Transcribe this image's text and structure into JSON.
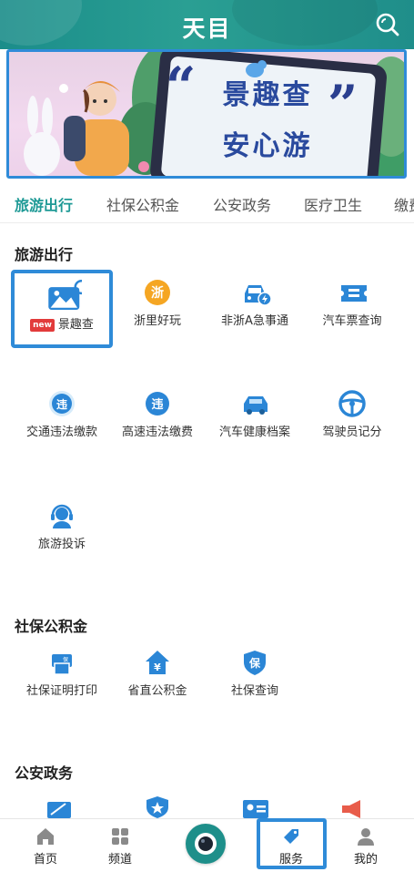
{
  "header": {
    "logo": "天目"
  },
  "banner": {
    "line1": "景趣查",
    "line2": "安心游"
  },
  "tabs": [
    "旅游出行",
    "社保公积金",
    "公安政务",
    "医疗卫生",
    "缴费"
  ],
  "sections": {
    "travel": {
      "title": "旅游出行",
      "items": [
        {
          "label": "景趣查",
          "badge": "new",
          "icon": "landscape-search-icon"
        },
        {
          "label": "浙里好玩",
          "badge": "浙",
          "icon": "zhe-badge-icon"
        },
        {
          "label": "非浙A急事通",
          "icon": "car-lightning-icon"
        },
        {
          "label": "汽车票查询",
          "icon": "bus-ticket-icon"
        },
        {
          "label": "交通违法缴款",
          "badge": "违",
          "icon": "traffic-violation-icon"
        },
        {
          "label": "高速违法缴费",
          "badge": "违",
          "icon": "highway-violation-icon"
        },
        {
          "label": "汽车健康档案",
          "icon": "car-health-icon"
        },
        {
          "label": "驾驶员记分",
          "icon": "steering-wheel-icon"
        },
        {
          "label": "旅游投诉",
          "icon": "headset-icon"
        }
      ]
    },
    "social": {
      "title": "社保公积金",
      "items": [
        {
          "label": "社保证明打印",
          "badge": "保",
          "icon": "printer-icon"
        },
        {
          "label": "省直公积金",
          "badge": "¥",
          "icon": "house-fund-icon"
        },
        {
          "label": "社保查询",
          "badge": "保",
          "icon": "shield-insurance-icon"
        }
      ]
    },
    "police": {
      "title": "公安政务"
    }
  },
  "bottomnav": {
    "home": "首页",
    "channel": "频道",
    "service": "服务",
    "mine": "我的"
  },
  "colors": {
    "brand": "#1f9a96",
    "highlight": "#2f8bd8",
    "icon_blue": "#2b86d6",
    "icon_orange": "#f39c12",
    "badge_red": "#e23b3b"
  }
}
